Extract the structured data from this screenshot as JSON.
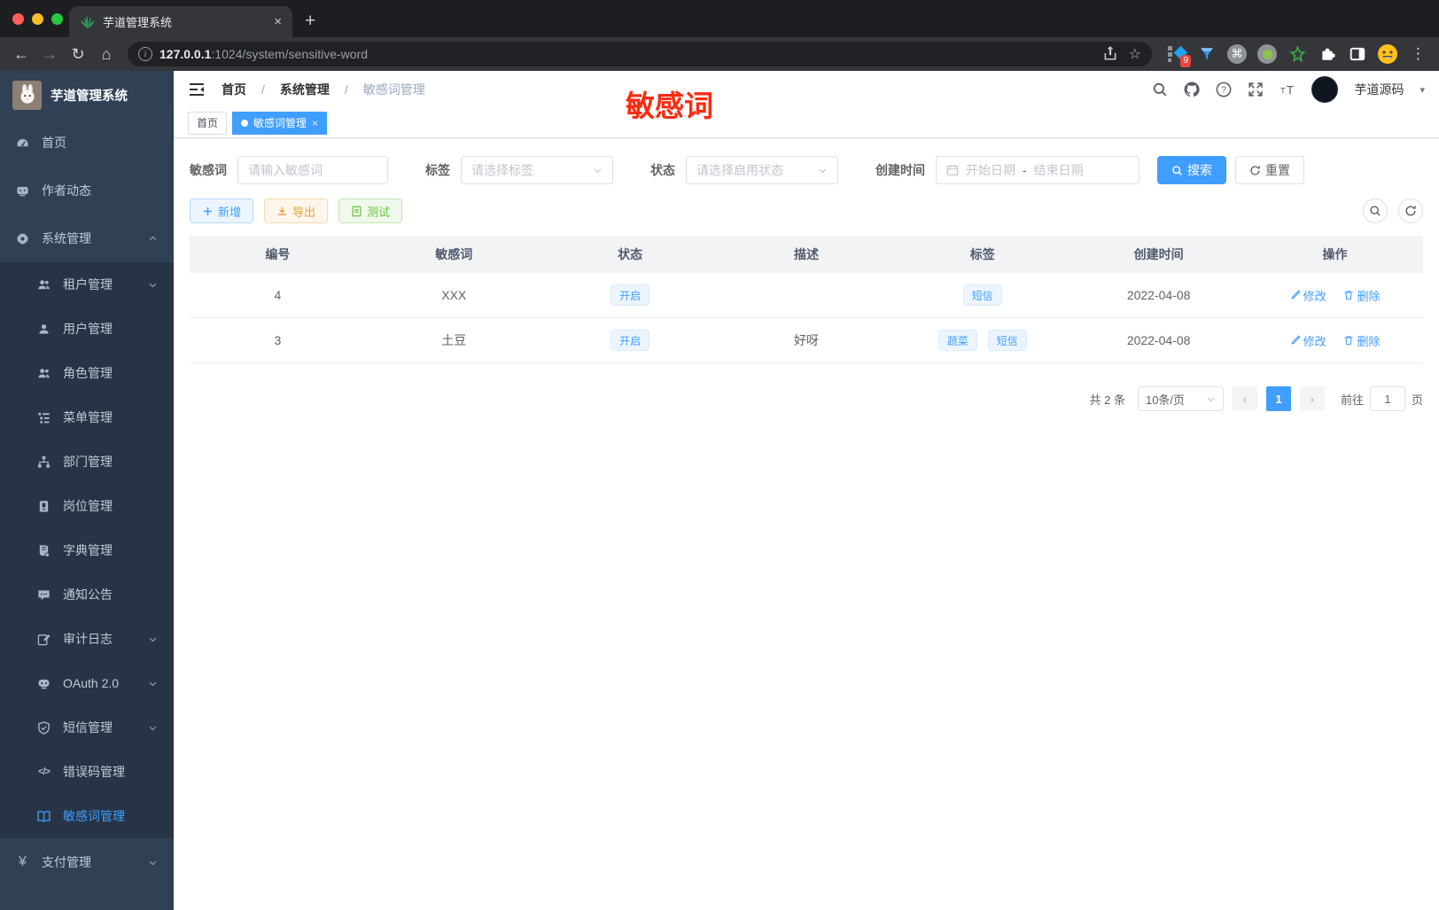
{
  "browser": {
    "tab_title": "芋道管理系统",
    "url_host": "127.0.0.1",
    "url_rest": ":1024/system/sensitive-word",
    "extension_badge": "9"
  },
  "icons": {
    "close": "×",
    "plus": "+",
    "overflow": "⋮",
    "back": "←",
    "forward": "→",
    "reload": "↻",
    "home": "⌂",
    "star": "☆",
    "command": "⌘",
    "info": "i",
    "yen": "¥",
    "code": "</>",
    "slash": "/",
    "caret": "▾",
    "prev": "‹",
    "next": "›"
  },
  "sidebar": {
    "logo_title": "芋道管理系统",
    "items": [
      {
        "label": "首页"
      },
      {
        "label": "作者动态"
      },
      {
        "label": "系统管理"
      },
      {
        "label": "租户管理"
      },
      {
        "label": "用户管理"
      },
      {
        "label": "角色管理"
      },
      {
        "label": "菜单管理"
      },
      {
        "label": "部门管理"
      },
      {
        "label": "岗位管理"
      },
      {
        "label": "字典管理"
      },
      {
        "label": "通知公告"
      },
      {
        "label": "审计日志"
      },
      {
        "label": "OAuth 2.0"
      },
      {
        "label": "短信管理"
      },
      {
        "label": "错误码管理"
      },
      {
        "label": "敏感词管理"
      },
      {
        "label": "支付管理"
      }
    ]
  },
  "header": {
    "breadcrumb": [
      "首页",
      "系统管理",
      "敏感词管理"
    ],
    "user_name": "芋道源码",
    "annotation": "敏感词"
  },
  "tags": [
    {
      "label": "首页"
    },
    {
      "label": "敏感词管理"
    }
  ],
  "filters": {
    "keyword_label": "敏感词",
    "keyword_placeholder": "请输入敏感词",
    "tag_label": "标签",
    "tag_placeholder": "请选择标签",
    "status_label": "状态",
    "status_placeholder": "请选择启用状态",
    "date_label": "创建时间",
    "date_start": "开始日期",
    "date_sep": "-",
    "date_end": "结束日期",
    "search_label": "搜索",
    "reset_label": "重置"
  },
  "toolbar": {
    "add_label": "新增",
    "export_label": "导出",
    "test_label": "测试"
  },
  "table": {
    "headers": [
      "编号",
      "敏感词",
      "状态",
      "描述",
      "标签",
      "创建时间",
      "操作"
    ],
    "edit_label": "修改",
    "delete_label": "删除",
    "rows": [
      {
        "id": "4",
        "word": "XXX",
        "status": "开启",
        "desc": "",
        "tags": [
          "短信"
        ],
        "created": "2022-04-08"
      },
      {
        "id": "3",
        "word": "土豆",
        "status": "开启",
        "desc": "好呀",
        "tags": [
          "蔬菜",
          "短信"
        ],
        "created": "2022-04-08"
      }
    ]
  },
  "pagination": {
    "total_label": "共 2 条",
    "page_size": "10条/页",
    "current_page": "1",
    "goto_label": "前往",
    "goto_value": "1",
    "page_unit": "页"
  }
}
